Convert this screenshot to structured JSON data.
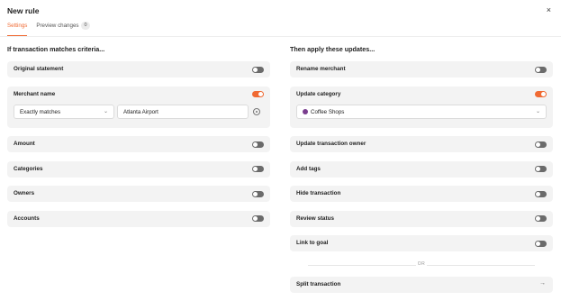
{
  "header": {
    "title": "New rule",
    "close_glyph": "×"
  },
  "tabs": [
    {
      "label": "Settings",
      "active": true
    },
    {
      "label": "Preview changes",
      "count": "0",
      "active": false
    }
  ],
  "left": {
    "title": "If transaction matches criteria...",
    "rows": {
      "original_statement": {
        "label": "Original statement",
        "on": false
      },
      "merchant_name": {
        "label": "Merchant name",
        "on": true,
        "match_type": "Exactly matches",
        "value": "Atlanta Airport"
      },
      "amount": {
        "label": "Amount",
        "on": false
      },
      "categories": {
        "label": "Categories",
        "on": false
      },
      "owners": {
        "label": "Owners",
        "on": false
      },
      "accounts": {
        "label": "Accounts",
        "on": false
      }
    }
  },
  "right": {
    "title": "Then apply these updates...",
    "rows": {
      "rename_merchant": {
        "label": "Rename merchant",
        "on": false
      },
      "update_category": {
        "label": "Update category",
        "on": true,
        "category": "Coffee Shops"
      },
      "update_owner": {
        "label": "Update transaction owner",
        "on": false
      },
      "add_tags": {
        "label": "Add tags",
        "on": false
      },
      "hide_transaction": {
        "label": "Hide transaction",
        "on": false
      },
      "review_status": {
        "label": "Review status",
        "on": false
      },
      "link_to_goal": {
        "label": "Link to goal",
        "on": false
      }
    },
    "or_text": "OR",
    "split": {
      "label": "Split transaction",
      "arrow_glyph": "→"
    }
  },
  "colors": {
    "accent": "#f06a33",
    "toggle_off": "#6b6b6b",
    "row_bg": "#f3f3f3",
    "category_dot": "#7a3e8e"
  },
  "icons": {
    "chevron": "chevron-down-icon",
    "remove": "circle-remove-icon",
    "close": "close-icon",
    "arrow": "arrow-right-icon"
  }
}
